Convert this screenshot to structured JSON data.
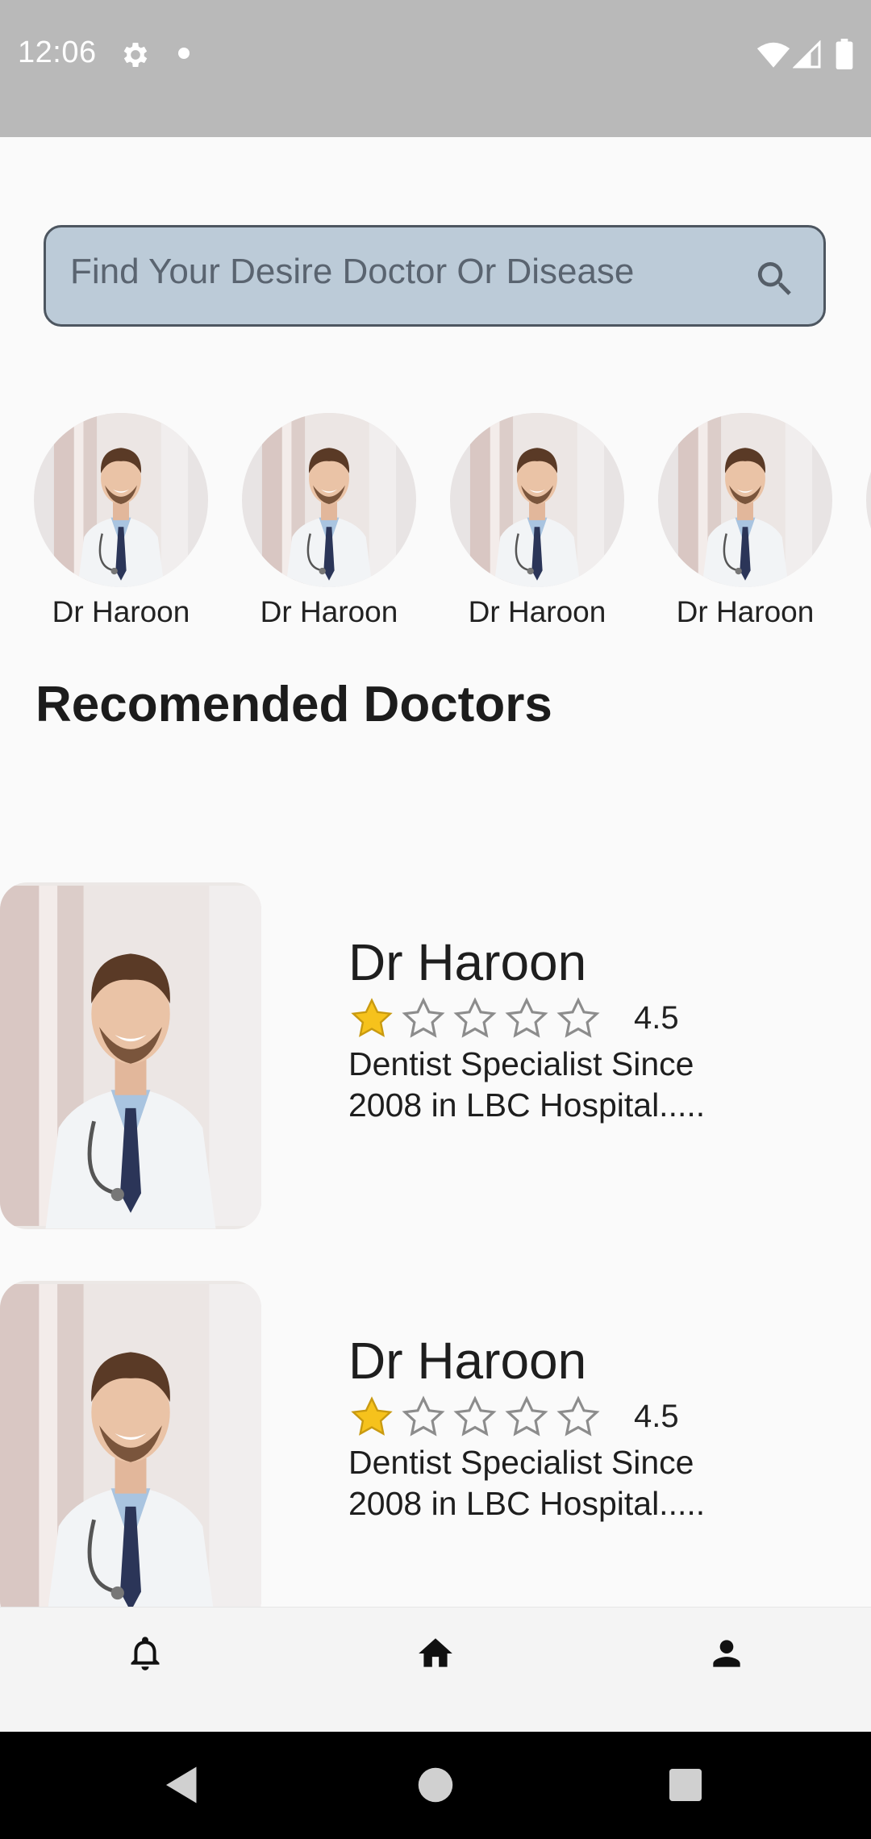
{
  "status_bar": {
    "time": "12:06"
  },
  "search": {
    "placeholder": "Find Your Desire Doctor Or Disease",
    "icon": "search-icon"
  },
  "avatars": [
    {
      "name": "Dr Haroon"
    },
    {
      "name": "Dr Haroon"
    },
    {
      "name": "Dr Haroon"
    },
    {
      "name": "Dr Haroon"
    }
  ],
  "section_title": "Recomended Doctors",
  "doctors": [
    {
      "name": "Dr Haroon",
      "rating": "4.5",
      "filled_stars": 1,
      "total_stars": 5,
      "description": "Dentist Specialist Since 2008 in LBC Hospital....."
    },
    {
      "name": "Dr Haroon",
      "rating": "4.5",
      "filled_stars": 1,
      "total_stars": 5,
      "description": "Dentist Specialist Since 2008 in LBC Hospital....."
    }
  ],
  "bottom_nav": [
    {
      "icon": "bell-icon"
    },
    {
      "icon": "home-icon"
    },
    {
      "icon": "person-icon"
    }
  ],
  "colors": {
    "status_bar": "#b9b9b9",
    "search_fill": "#bccbd8",
    "search_border": "#4d5660",
    "star_filled": "#f6c21c",
    "star_empty": "#8c8c8c",
    "background": "#fafafa"
  }
}
